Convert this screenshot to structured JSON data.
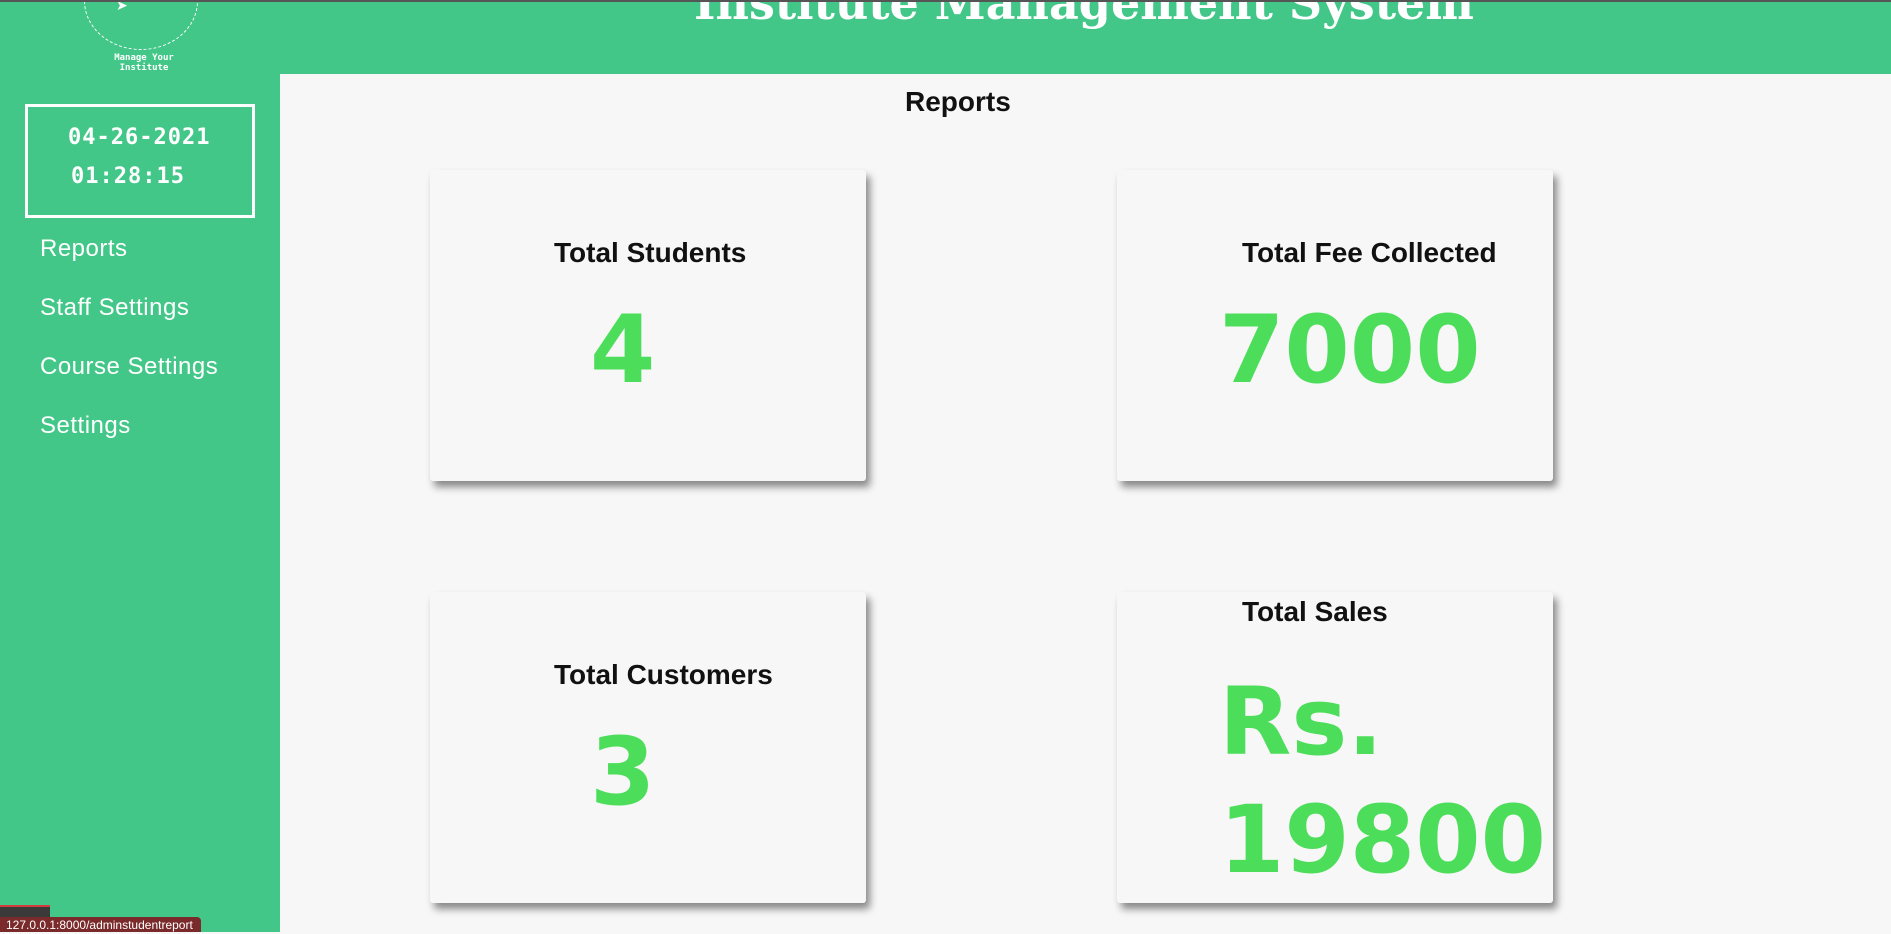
{
  "header": {
    "title": "Institute Management System",
    "logo_tagline": "Manage Your Institute",
    "logo_icon": "paper-plane-icon",
    "background_color": "#43c789"
  },
  "sidebar": {
    "clock": {
      "date": "04-26-2021",
      "time": "01:28:15"
    },
    "items": [
      {
        "label": "Reports"
      },
      {
        "label": "Staff Settings"
      },
      {
        "label": "Course Settings"
      },
      {
        "label": "Settings"
      }
    ]
  },
  "main": {
    "title": "Reports",
    "cards": [
      {
        "title": "Total Students",
        "value": "4"
      },
      {
        "title": "Total Fee Collected",
        "value": "7000"
      },
      {
        "title": "Total Customers",
        "value": "3"
      },
      {
        "title": "Total Sales",
        "value": "Rs. 19800"
      }
    ],
    "value_color": "#4cde5a"
  },
  "status_bar": {
    "url": "127.0.0.1:8000/adminstudentreport"
  }
}
